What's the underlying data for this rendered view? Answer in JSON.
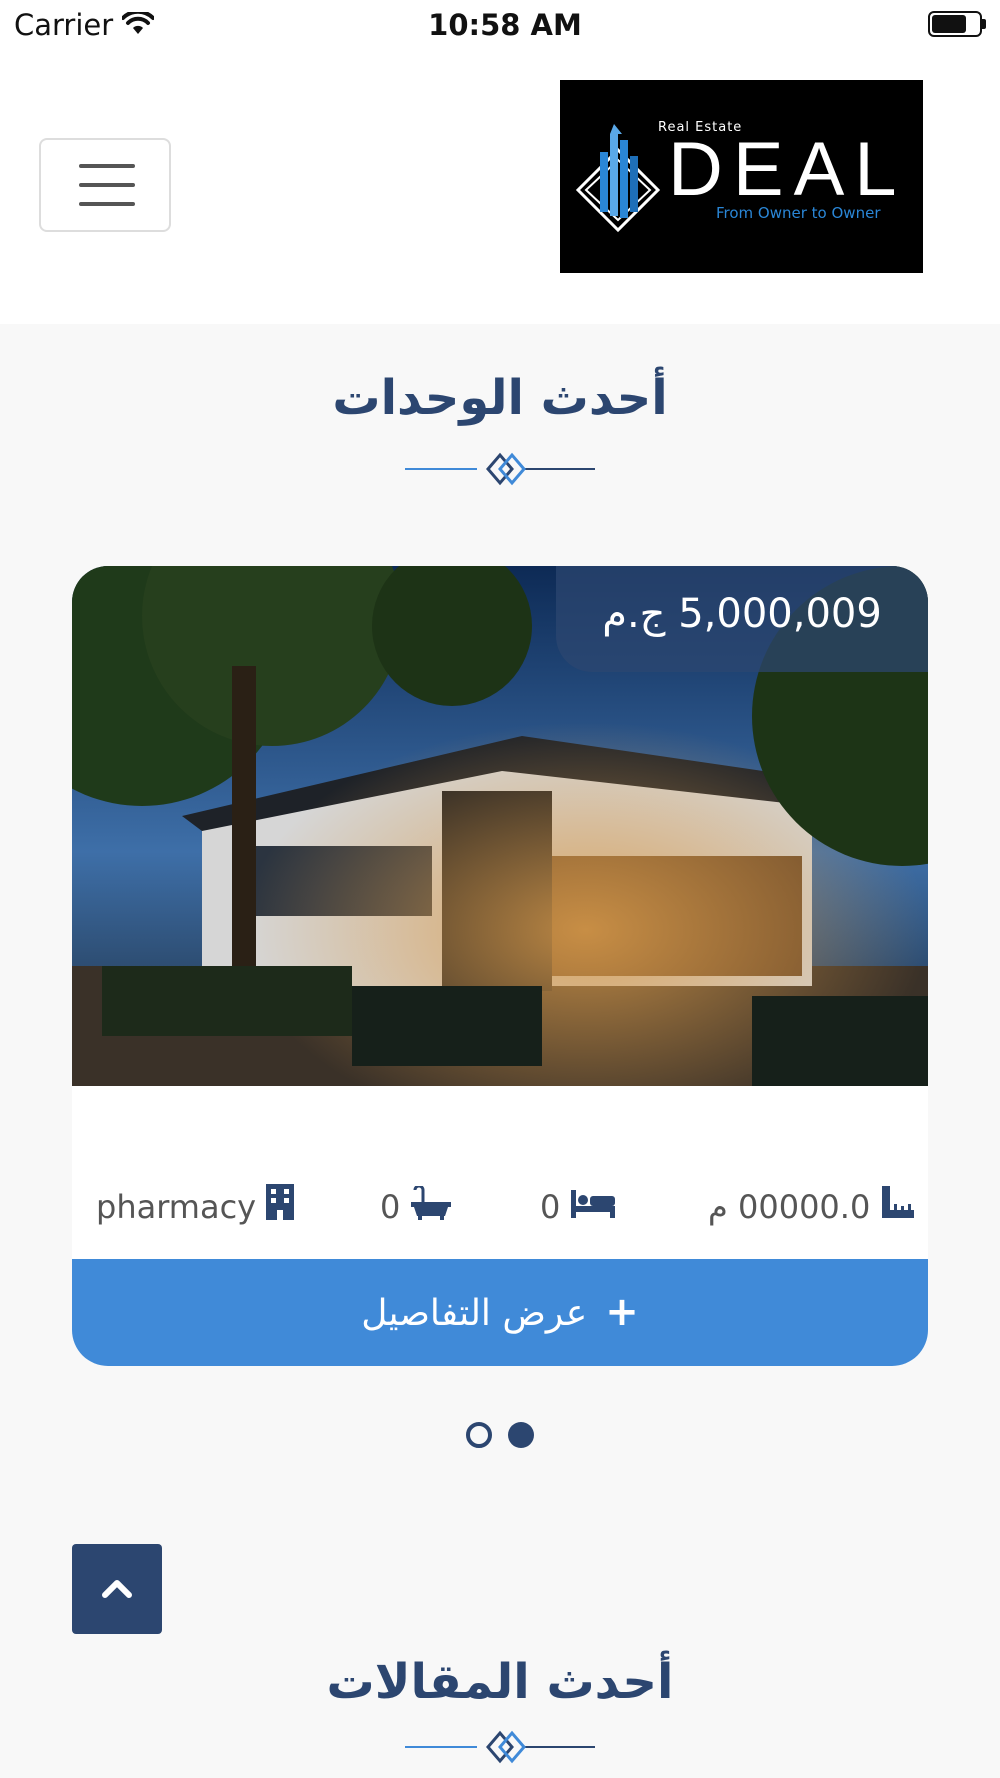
{
  "status_bar": {
    "carrier": "Carrier",
    "time": "10:58 AM"
  },
  "header": {
    "logo": {
      "small_text": "Real Estate",
      "brand": "DEAL",
      "tagline": "From Owner to Owner"
    }
  },
  "sections": {
    "units_title": "أحدث الوحدات",
    "articles_title": "أحدث المقالات"
  },
  "unit_card": {
    "price": "5,000,009 ج.م",
    "area": "00000.0 م",
    "bedrooms": "0",
    "bathrooms": "0",
    "type": "pharmacy",
    "details_button": "عرض التفاصيل"
  },
  "pager": {
    "count": 2,
    "active_index": 1
  },
  "colors": {
    "primary": "#2c4670",
    "accent": "#408ad8",
    "background": "#f8f8f8"
  },
  "icons": [
    "wifi-icon",
    "battery-icon",
    "hamburger-icon",
    "ruler-icon",
    "bed-icon",
    "bath-icon",
    "building-icon",
    "plus-icon",
    "chevron-up-icon"
  ]
}
